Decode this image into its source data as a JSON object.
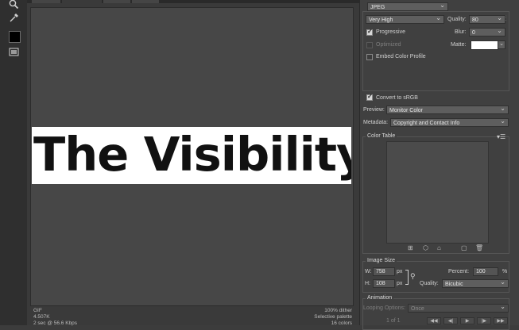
{
  "tools": [
    {
      "name": "zoom-icon"
    },
    {
      "name": "eyedropper-icon"
    },
    {
      "name": "color-swatch"
    },
    {
      "name": "slice-visibility-icon"
    }
  ],
  "preview": {
    "image_text": "The Visibility H",
    "status_left": [
      "GIF",
      "4.507K",
      "2 sec @ 56.6 Kbps"
    ],
    "status_right": [
      "100% dither",
      "Selective palette",
      "16 colors"
    ]
  },
  "settings": {
    "format": "JPEG",
    "quality_preset": "Very High",
    "quality_label": "Quality:",
    "quality_value": "80",
    "progressive_label": "Progressive",
    "blur_label": "Blur:",
    "blur_value": "0",
    "optimized_label": "Optimized",
    "matte_label": "Matte:",
    "embed_label": "Embed Color Profile"
  },
  "color": {
    "convert_label": "Convert to sRGB",
    "preview_label": "Preview:",
    "preview_value": "Monitor Color",
    "metadata_label": "Metadata:",
    "metadata_value": "Copyright and Contact Info"
  },
  "color_table": {
    "title": "Color Table"
  },
  "image_size": {
    "title": "Image Size",
    "w_label": "W:",
    "w_value": "758",
    "h_label": "H:",
    "h_value": "108",
    "unit": "px",
    "percent_label": "Percent:",
    "percent_value": "100",
    "percent_unit": "%",
    "quality_label": "Quality:",
    "quality_value": "Bicubic"
  },
  "animation": {
    "title": "Animation",
    "looping_label": "Looping Options:",
    "looping_value": "Once",
    "frame_counter": "1 of 1"
  }
}
